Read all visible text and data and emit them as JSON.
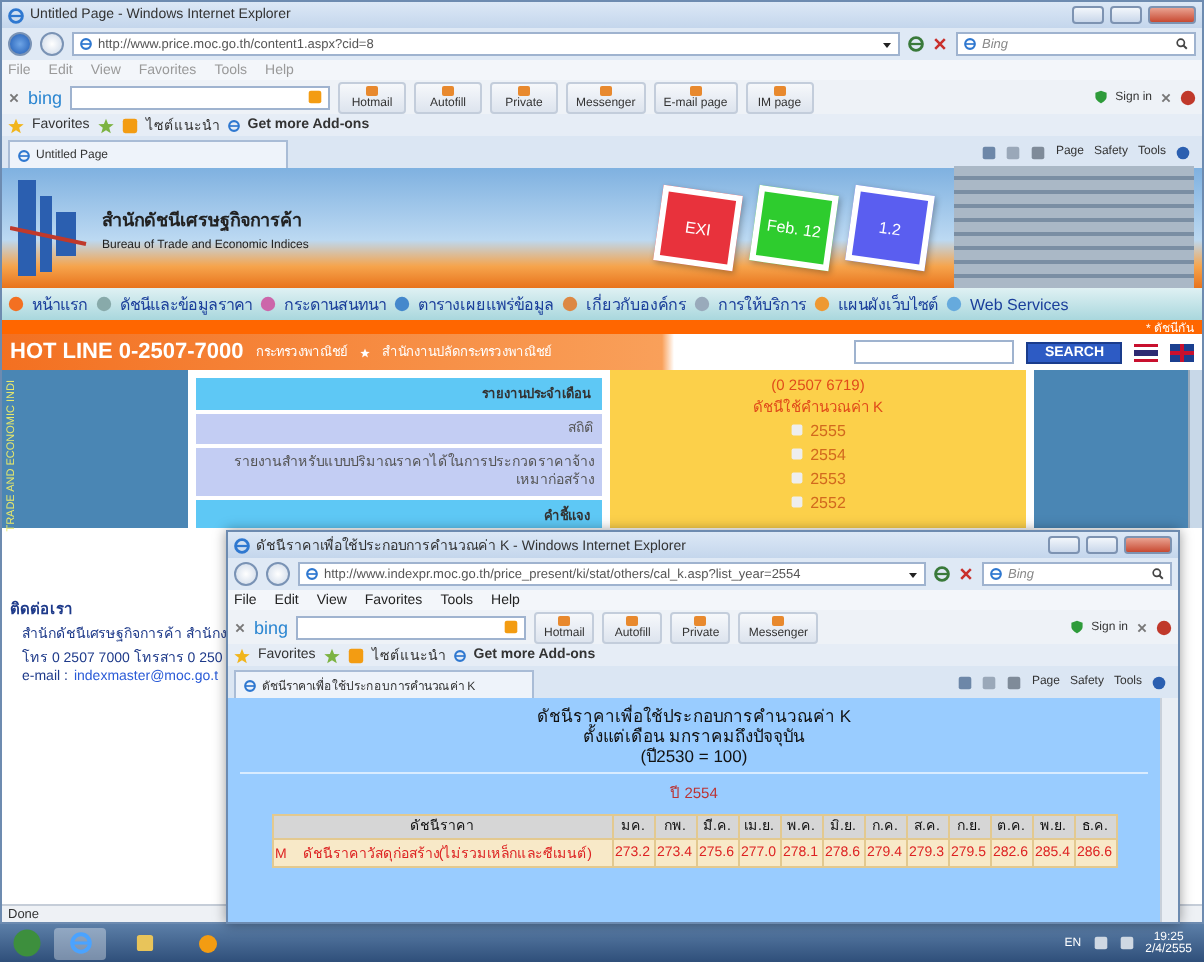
{
  "back_window": {
    "title": "Untitled Page - Windows Internet Explorer",
    "address": "http://www.price.moc.go.th/content1.aspx?cid=8",
    "search_placeholder": "Bing",
    "menu": [
      "File",
      "Edit",
      "View",
      "Favorites",
      "Tools",
      "Help"
    ],
    "toolbar": {
      "brand": "bing",
      "buttons": [
        "Hotmail",
        "Autofill",
        "Private",
        "Messenger",
        "E-mail page",
        "IM page"
      ],
      "sign_in": "Sign in"
    },
    "favorites": {
      "label": "Favorites",
      "items": [
        "ไซต์แนะนำ",
        "Get more Add-ons"
      ]
    },
    "tab": "Untitled Page",
    "commands": [
      "Page",
      "Safety",
      "Tools"
    ],
    "page": {
      "logo": {
        "thai": "สำนักดัชนีเศรษฐกิจการค้า",
        "english": "Bureau of Trade and Economic Indices"
      },
      "tiles": [
        {
          "label": "EXI",
          "color": "#e8323c"
        },
        {
          "label": "Feb. 12",
          "color": "#2ecc2e"
        },
        {
          "label": "1.2",
          "color": "#5a5ef0"
        }
      ],
      "nav": [
        "หน้าแรก",
        "ดัชนีและข้อมูลราคา",
        "กระดานสนทนา",
        "ตารางเผยแพร่ข้อมูล",
        "เกี่ยวกับองค์กร",
        "การให้บริการ",
        "แผนผังเว็บไซต์",
        "Web Services"
      ],
      "ticker": "* ดัชนีกัน",
      "hotline": "HOT LINE 0-2507-7000",
      "breadcrumb": [
        "กระทรวงพาณิชย์",
        "สำนักงานปลัดกระทรวงพาณิชย์"
      ],
      "search_button": "SEARCH",
      "sidebar_text": "TRADE AND ECONOMIC INDI",
      "center": [
        {
          "kind": "header",
          "text": "รายงานประจำเดือน"
        },
        {
          "kind": "link",
          "text": "สถิติ"
        },
        {
          "kind": "link",
          "text": "รายงานสำหรับแบบปริมาณราคาได้ในการประกวดราคาจ้างเหมาก่อสร้าง"
        },
        {
          "kind": "header",
          "text": "คำชี้แจง"
        }
      ],
      "yellow": {
        "lines": [
          "(0 2507 6719)",
          "ดัชนีใช้คำนวณค่า K"
        ],
        "years": [
          "2555",
          "2554",
          "2553",
          "2552"
        ]
      },
      "contact": {
        "title": "ติดต่อเรา",
        "lines": [
          "สำนักดัชนีเศรษฐกิจการค้า สำนักง",
          "โทร 0 2507 7000 โทรสาร 0 250"
        ],
        "email_label": "e-mail :",
        "email": "indexmaster@moc.go.t"
      }
    },
    "status_bar": "Done"
  },
  "front_window": {
    "title": "ดัชนีราคาเพื่อใช้ประกอบการคำนวณค่า K - Windows Internet Explorer",
    "address": "http://www.indexpr.moc.go.th/price_present/ki/stat/others/cal_k.asp?list_year=2554",
    "search_placeholder": "Bing",
    "menu": [
      "File",
      "Edit",
      "View",
      "Favorites",
      "Tools",
      "Help"
    ],
    "toolbar": {
      "brand": "bing",
      "buttons": [
        "Hotmail",
        "Autofill",
        "Private",
        "Messenger"
      ],
      "sign_in": "Sign in"
    },
    "favorites": {
      "label": "Favorites",
      "items": [
        "ไซต์แนะนำ",
        "Get more Add-ons"
      ]
    },
    "tab": "ดัชนีราคาเพื่อใช้ประกอบการคำนวณค่า K",
    "commands": [
      "Page",
      "Safety",
      "Tools"
    ],
    "page": {
      "headings": [
        "ดัชนีราคาเพื่อใช้ประกอบการคำนวณค่า K",
        "ตั้งแต่เดือน มกราคมถึงปัจจุบัน",
        "(ปี2530 = 100)"
      ],
      "year": "ปี 2554",
      "table": {
        "columns": [
          "ดัชนีราคา",
          "มค.",
          "กพ.",
          "มี.ค.",
          "เม.ย.",
          "พ.ค.",
          "มิ.ย.",
          "ก.ค.",
          "ส.ค.",
          "ก.ย.",
          "ต.ค.",
          "พ.ย.",
          "ธ.ค."
        ],
        "rows": [
          {
            "code": "M",
            "name": "ดัชนีราคาวัสดุก่อสร้าง(ไม่รวมเหล็กและซีเมนต์)",
            "values": [
              "273.2",
              "273.4",
              "275.6",
              "277.0",
              "278.1",
              "278.6",
              "279.4",
              "279.3",
              "279.5",
              "282.6",
              "285.4",
              "286.6"
            ]
          }
        ]
      }
    }
  },
  "taskbar": {
    "language": "EN",
    "time": "19:25",
    "date": "2/4/2555"
  }
}
